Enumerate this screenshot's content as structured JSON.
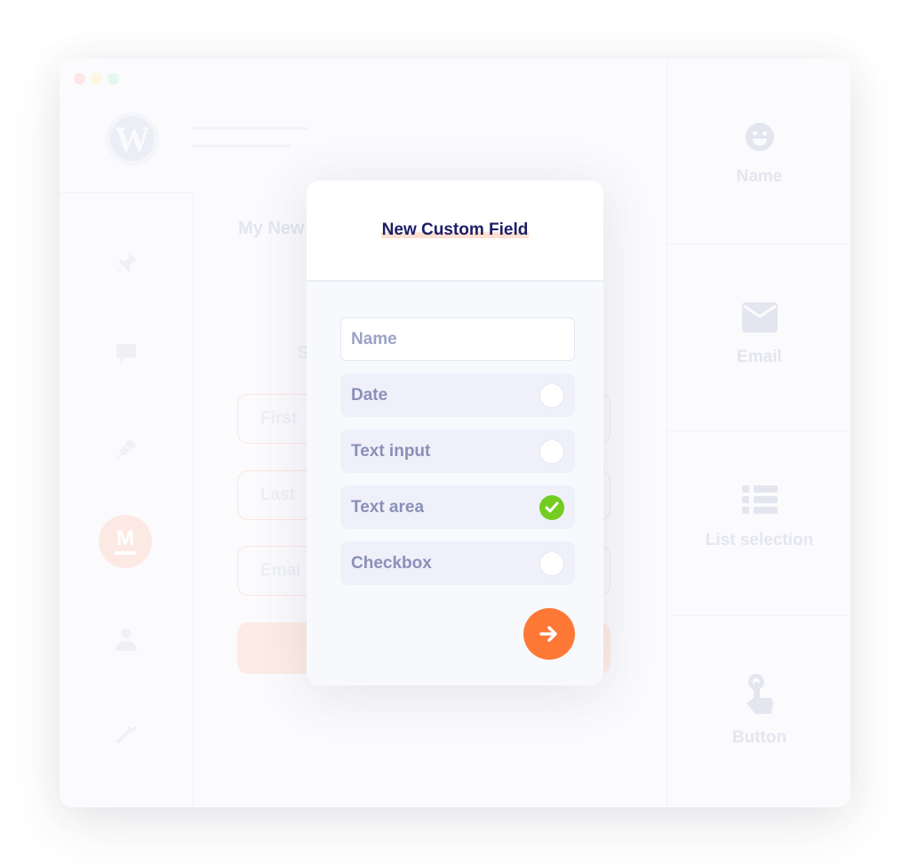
{
  "window": {
    "traffic_lights": [
      "close",
      "minimize",
      "maximize"
    ],
    "logo_icon": "wordpress-logo-icon"
  },
  "sidebar": {
    "icons": [
      "pin-icon",
      "comment-icon",
      "brush-icon",
      "plugin-m-icon",
      "user-icon",
      "wrench-icon"
    ],
    "badge_letter": "M"
  },
  "main": {
    "title": "My New",
    "subtitle": "S",
    "inputs": [
      "First",
      "Last",
      "Emai"
    ]
  },
  "right_panel": {
    "items": [
      {
        "icon": "smiley-icon",
        "label": "Name"
      },
      {
        "icon": "envelope-icon",
        "label": "Email"
      },
      {
        "icon": "list-icon",
        "label": "List selection"
      },
      {
        "icon": "pointer-hand-icon",
        "label": "Button"
      }
    ]
  },
  "modal": {
    "title": "New Custom Field",
    "name_placeholder": "Name",
    "options": [
      {
        "label": "Date",
        "checked": false
      },
      {
        "label": "Text input",
        "checked": false
      },
      {
        "label": "Text area",
        "checked": true
      },
      {
        "label": "Checkbox",
        "checked": false
      }
    ],
    "next_icon": "arrow-right-icon"
  },
  "colors": {
    "accent": "#fd7935",
    "check": "#74cc22",
    "title": "#1b1f66",
    "label": "#8a90b8"
  }
}
